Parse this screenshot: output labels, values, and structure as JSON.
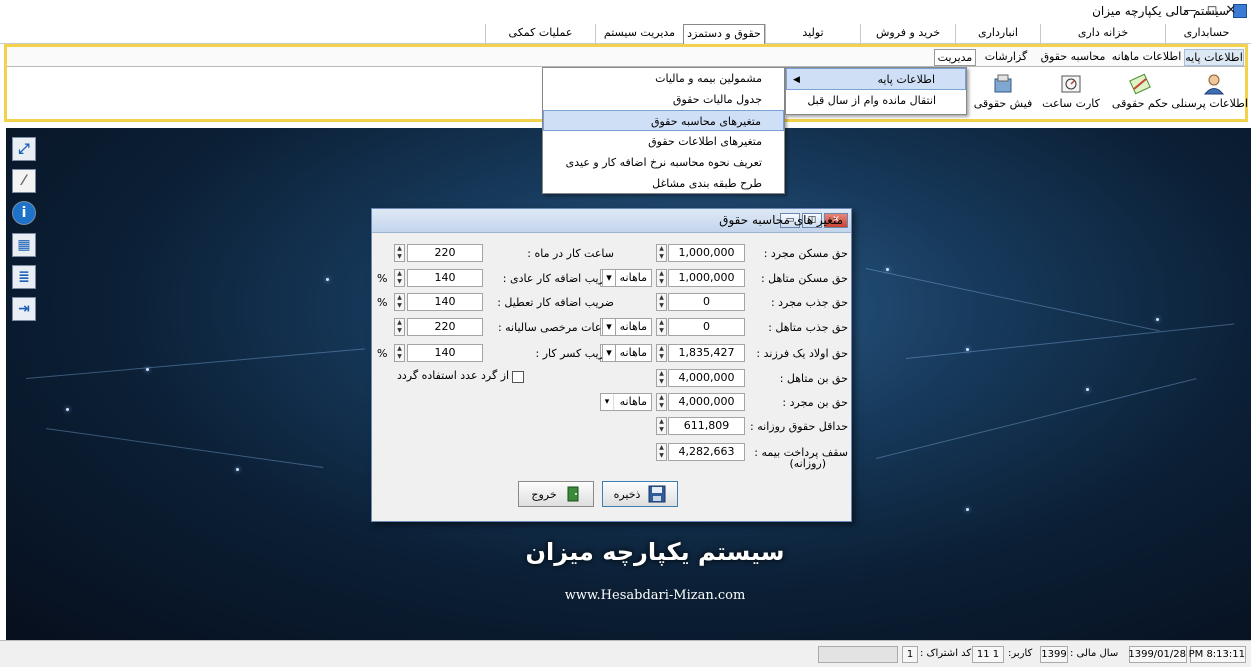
{
  "window": {
    "title": "سیستم مالی یکپارچه میزان",
    "minimize": "—",
    "maximize": "◻",
    "close": "✕"
  },
  "menu": {
    "tabs": [
      "حسابداری",
      "خزانه داری",
      "انبارداری",
      "خرید و فروش",
      "تولید",
      "حقوق و دستمزد",
      "مدیریت سیستم",
      "عملیات کمکی"
    ],
    "active_index": 5
  },
  "ribbon": {
    "tabs": [
      "اطلاعات پایه",
      "اطلاعات ماهانه",
      "محاسبه حقوق",
      "گزارشات",
      "مدیریت"
    ],
    "active_index": 0,
    "boxed_index": 4,
    "buttons": [
      {
        "label": "اطلاعات پرسنلی",
        "icon": "person-icon"
      },
      {
        "label": "حکم حقوقی",
        "icon": "decree-icon"
      },
      {
        "label": "کارت ساعت",
        "icon": "timecard-icon"
      },
      {
        "label": "فیش حقوقی",
        "icon": "payslip-icon"
      }
    ]
  },
  "submenu": {
    "items": [
      "مشمولین بیمه و مالیات",
      "جدول مالیات حقوق",
      "متغیرهای محاسبه حقوق",
      "متغیرهای اطلاعات حقوق",
      "تعریف نحوه محاسبه نرخ اضافه کار و عیدی",
      "طرح طبقه بندی مشاغل"
    ],
    "highlighted_index": 2
  },
  "popmenu": {
    "items": [
      "اطلاعات پایه",
      "انتقال مانده وام از سال قبل"
    ],
    "highlighted_index": 0
  },
  "dialog": {
    "title": "متغیر های محاسبه حقوق",
    "right_fields": [
      {
        "label": "حق مسکن مجرد :",
        "value": "1,000,000",
        "period": ""
      },
      {
        "label": "حق مسکن متاهل :",
        "value": "1,000,000",
        "period": "ماهانه"
      },
      {
        "label": "حق جذب مجرد :",
        "value": "0",
        "period": ""
      },
      {
        "label": "حق جذب متاهل :",
        "value": "0",
        "period": "ماهانه"
      },
      {
        "label": "حق اولاد یک فرزند :",
        "value": "1,835,427",
        "period": "ماهانه"
      },
      {
        "label": "حق بن متاهل :",
        "value": "4,000,000",
        "period": ""
      },
      {
        "label": "حق بن مجرد :",
        "value": "4,000,000",
        "period": "ماهانه"
      },
      {
        "label": "حداقل حقوق روزانه :",
        "value": "611,809",
        "period": ""
      },
      {
        "label": "سقف پرداخت بیمه :",
        "label2": "(روزانه)",
        "value": "4,282,663",
        "period": ""
      }
    ],
    "left_fields": [
      {
        "label": "ساعت کار در ماه :",
        "value": "220",
        "pct": ""
      },
      {
        "label": "ضریب اضافه کار عادی :",
        "value": "140",
        "pct": "%"
      },
      {
        "label": "ضریب اضافه کار تعطیل :",
        "value": "140",
        "pct": "%"
      },
      {
        "label": "ساعات مرخصی سالیانه :",
        "value": "220",
        "pct": ""
      },
      {
        "label": "ضریب کسر کار :",
        "value": "140",
        "pct": "%"
      }
    ],
    "rounding_checkbox": "از گرد عدد استفاده گردد",
    "save_label": "ذخیره",
    "exit_label": "خروج"
  },
  "branding": {
    "name": "سیستم یکپارچه میزان",
    "url": "www.Hesabdari-Mizan.com"
  },
  "statusbar": {
    "time": "PM 8:13:11",
    "date": "1399/01/28",
    "fiscal_year_label": "سال مالی :",
    "fiscal_year": "1399",
    "user_label": "کاربر:",
    "user_value": "1 11",
    "subscription_label": "کد اشتراک :",
    "subscription_value": "1"
  }
}
